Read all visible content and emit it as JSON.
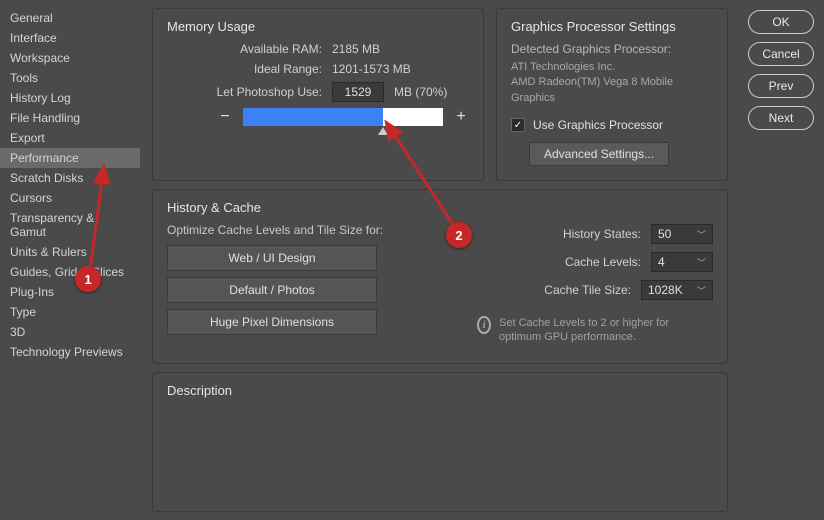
{
  "sidebar": {
    "items": [
      {
        "label": "General"
      },
      {
        "label": "Interface"
      },
      {
        "label": "Workspace"
      },
      {
        "label": "Tools"
      },
      {
        "label": "History Log"
      },
      {
        "label": "File Handling"
      },
      {
        "label": "Export"
      },
      {
        "label": "Performance",
        "selected": true
      },
      {
        "label": "Scratch Disks"
      },
      {
        "label": "Cursors"
      },
      {
        "label": "Transparency & Gamut"
      },
      {
        "label": "Units & Rulers"
      },
      {
        "label": "Guides, Grid & Slices"
      },
      {
        "label": "Plug-Ins"
      },
      {
        "label": "Type"
      },
      {
        "label": "3D"
      },
      {
        "label": "Technology Previews"
      }
    ]
  },
  "memory": {
    "title": "Memory Usage",
    "available_label": "Available RAM:",
    "available_value": "2185 MB",
    "ideal_label": "Ideal Range:",
    "ideal_value": "1201-1573 MB",
    "use_label": "Let Photoshop Use:",
    "use_value": "1529",
    "use_suffix": "MB (70%)",
    "slider_percent": 70,
    "minus": "−",
    "plus": "+"
  },
  "gpu": {
    "title": "Graphics Processor Settings",
    "detected_label": "Detected Graphics Processor:",
    "vendor": "ATI Technologies Inc.",
    "model": "AMD Radeon(TM) Vega 8 Mobile Graphics",
    "checkbox_label": "Use Graphics Processor",
    "checked": true,
    "advanced_label": "Advanced Settings..."
  },
  "history_cache": {
    "title": "History & Cache",
    "optimize_label": "Optimize Cache Levels and Tile Size for:",
    "presets": [
      "Web / UI Design",
      "Default / Photos",
      "Huge Pixel Dimensions"
    ],
    "states_label": "History States:",
    "states_value": "50",
    "levels_label": "Cache Levels:",
    "levels_value": "4",
    "tile_label": "Cache Tile Size:",
    "tile_value": "1028K",
    "note": "Set Cache Levels to 2 or higher for optimum GPU performance."
  },
  "description": {
    "title": "Description"
  },
  "buttons": {
    "ok": "OK",
    "cancel": "Cancel",
    "prev": "Prev",
    "next": "Next"
  },
  "annotations": {
    "badge1": "1",
    "badge2": "2"
  }
}
